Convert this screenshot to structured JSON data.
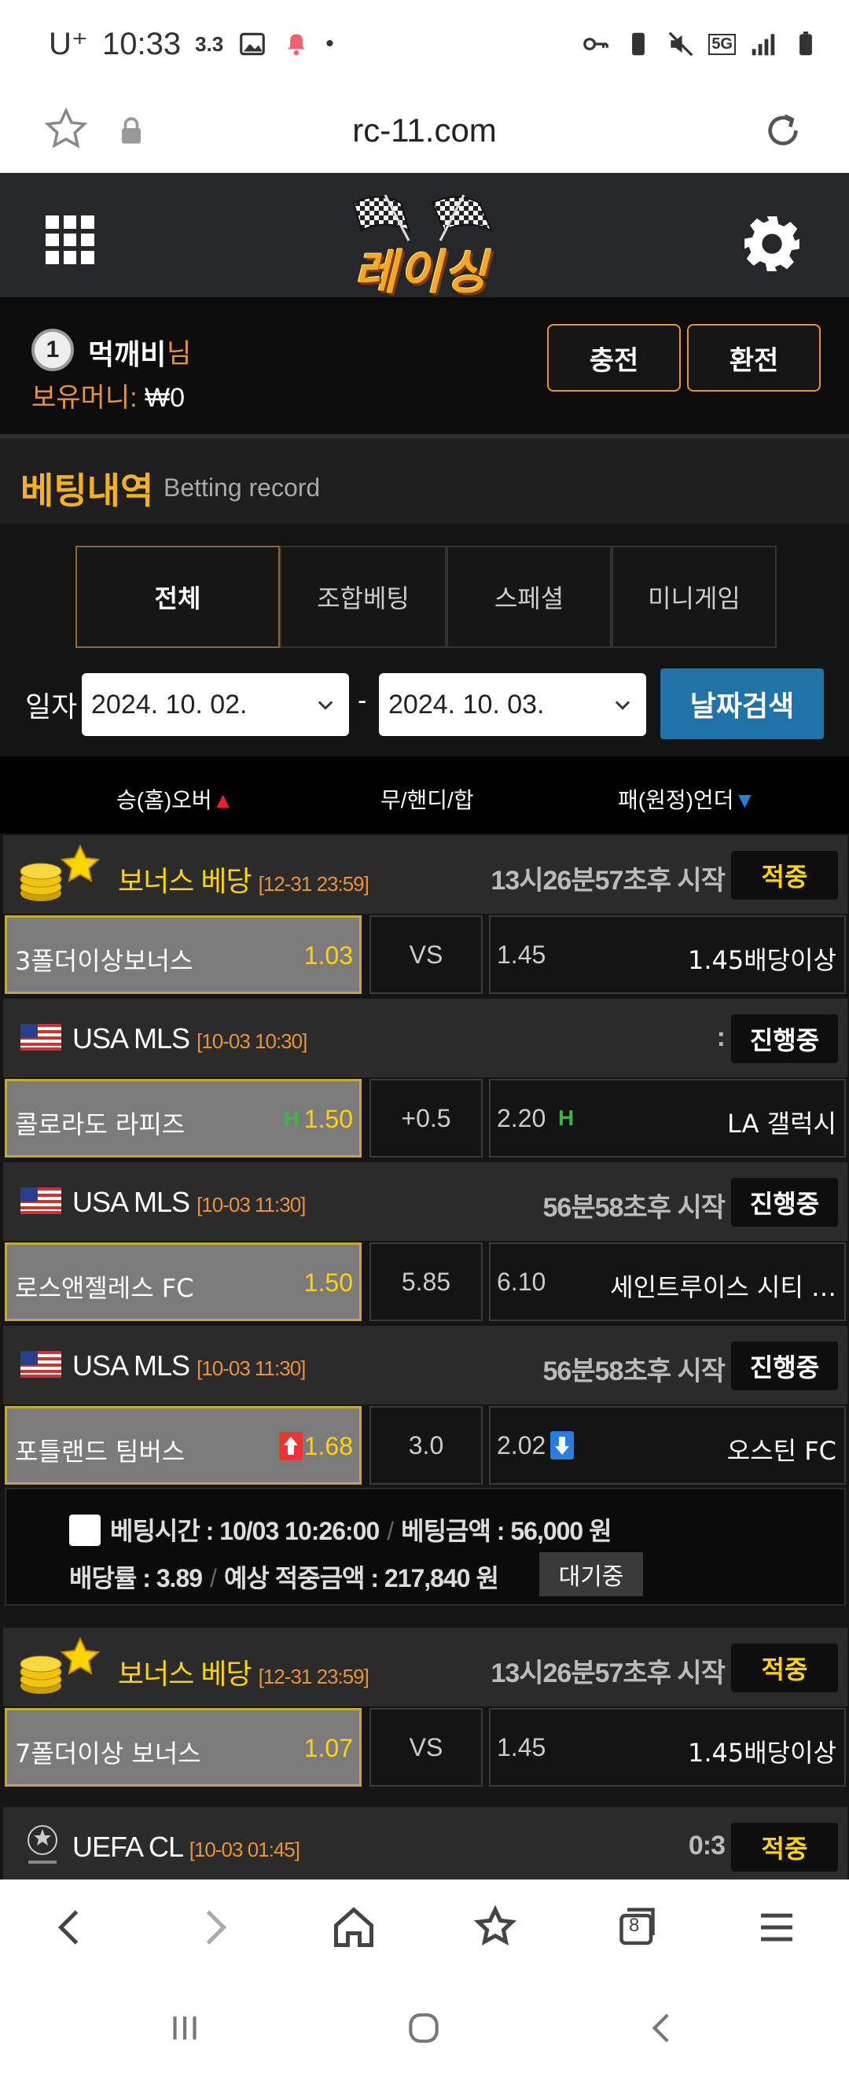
{
  "status_bar": {
    "carrier": "U⁺",
    "time": "10:33",
    "net_speed": "3.3",
    "network": "5G"
  },
  "browser": {
    "url": "rc-11.com"
  },
  "site": {
    "logo_text": "레이싱"
  },
  "user": {
    "rank": "1",
    "name": "먹깨비",
    "suffix": "님",
    "money_label": "보유머니: ",
    "money_value": "₩0",
    "charge_label": "충전",
    "exchange_label": "환전"
  },
  "section": {
    "title_ko": "베팅내역",
    "title_en": "Betting record"
  },
  "tabs": [
    {
      "label": "전체",
      "active": true
    },
    {
      "label": "조합베팅",
      "active": false
    },
    {
      "label": "스페셜",
      "active": false
    },
    {
      "label": "미니게임",
      "active": false
    }
  ],
  "date_filter": {
    "label": "일자",
    "from": "2024. 10. 02.",
    "dash": "-",
    "to": "2024. 10. 03.",
    "search_label": "날짜검색"
  },
  "columns": {
    "home": "승(홈)오버",
    "home_mark": "▲",
    "mid": "무/핸디/합",
    "away": "패(원정)언더",
    "away_mark": "▼"
  },
  "bets": [
    {
      "league": "보너스 베당",
      "time": "[12-31 23:59]",
      "status_text": "13시26분57초후 시작",
      "badge": "적중",
      "home": "3폴더이상보너스",
      "home_odd": "1.03",
      "mid": "VS",
      "away_odd": "1.45",
      "away": "1.45배당이상"
    },
    {
      "league": "USA MLS",
      "time": "[10-03 10:30]",
      "status_text": ":",
      "badge": "진행중",
      "home": "콜로라도 라피즈",
      "home_ind": "H",
      "home_odd": "1.50",
      "mid": "+0.5",
      "away_odd": "2.20",
      "away_ind": "H",
      "away": "LA 갤럭시"
    },
    {
      "league": "USA MLS",
      "time": "[10-03 11:30]",
      "status_text": "56분58초후 시작",
      "badge": "진행중",
      "home": "로스앤젤레스 FC",
      "home_odd": "1.50",
      "mid": "5.85",
      "away_odd": "6.10",
      "away": "세인트루이스 시티 …"
    },
    {
      "league": "USA MLS",
      "time": "[10-03 11:30]",
      "status_text": "56분58초후 시작",
      "badge": "진행중",
      "home": "포틀랜드 팀버스",
      "home_odd": "1.68",
      "mid": "3.0",
      "away_odd": "2.02",
      "away": "오스틴 FC"
    }
  ],
  "summary": {
    "bet_time_label": "베팅시간 : 10/03 10:26:00",
    "bet_amount_label": "베팅금액 : 56,000 원",
    "odds_label": "배당률 : 3.89",
    "expected_label": "예상 적중금액 : 217,840 원",
    "status_button": "대기중",
    "separator": "/"
  },
  "bets2": [
    {
      "league": "보너스 베당",
      "time": "[12-31 23:59]",
      "status_text": "13시26분57초후 시작",
      "badge": "적중",
      "home": "7폴더이상 보너스",
      "home_odd": "1.07",
      "mid": "VS",
      "away_odd": "1.45",
      "away": "1.45배당이상"
    },
    {
      "league": "UEFA CL",
      "time": "[10-03 01:45]",
      "status_text": "0:3",
      "badge": "적중"
    }
  ],
  "browser_nav": {
    "tab_count": "8"
  },
  "colors": {
    "accent_orange": "#e89436",
    "gold": "#f5b21a",
    "win_yellow": "#ffd400",
    "search_blue": "#1f73a6"
  }
}
